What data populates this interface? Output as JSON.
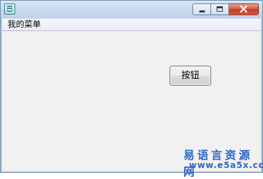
{
  "menu": {
    "items": [
      {
        "label": "我的菜单"
      }
    ]
  },
  "main": {
    "button_label": "按钮"
  },
  "watermark": {
    "site_name": "易语言资源网",
    "url": "www.e5a5x.com"
  },
  "window": {
    "controls": [
      "minimize-icon",
      "maximize-icon",
      "close-icon"
    ]
  },
  "colors": {
    "title_bar": "#c5d6ea",
    "client_background": "#f1f1f1",
    "close_button": "#c9452f",
    "watermark": "#2c63c9"
  }
}
